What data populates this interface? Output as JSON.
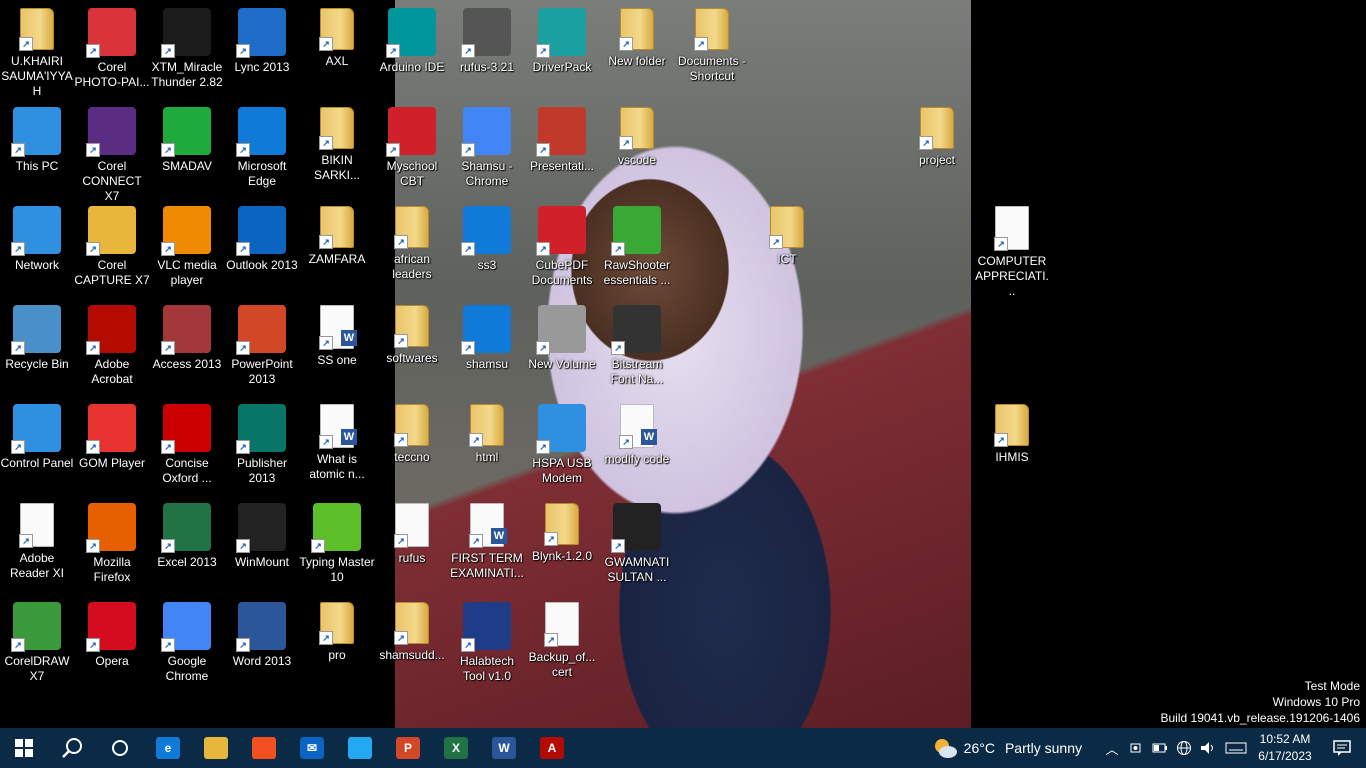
{
  "desktop": {
    "icons": [
      {
        "label": "U.KHAIRI SAUMA'IYYA H",
        "icon": "user-folder-icon",
        "color": "#e9c46a"
      },
      {
        "label": "Corel PHOTO-PAI...",
        "icon": "corel-photo-paint-icon",
        "color": "#d9343a"
      },
      {
        "label": "XTM_Miracle Thunder 2.82",
        "icon": "miracle-thunder-icon",
        "color": "#1b1b1b"
      },
      {
        "label": "Lync 2013",
        "icon": "lync-icon",
        "color": "#1e6ec8"
      },
      {
        "label": "AXL",
        "icon": "folder-icon",
        "color": "#e9c46a"
      },
      {
        "label": "Arduino IDE",
        "icon": "arduino-icon",
        "color": "#00979c"
      },
      {
        "label": "rufus-3.21",
        "icon": "usb-drive-icon",
        "color": "#555"
      },
      {
        "label": "DriverPack",
        "icon": "driverpack-icon",
        "color": "#1aa0a0"
      },
      {
        "label": "New folder",
        "icon": "folder-icon",
        "color": "#e9c46a"
      },
      {
        "label": "Documents - Shortcut",
        "icon": "documents-folder-icon",
        "color": "#e9c46a"
      },
      {
        "label": "This PC",
        "icon": "computer-icon",
        "color": "#2f8fe0"
      },
      {
        "label": "Corel CONNECT X7",
        "icon": "corel-connect-icon",
        "color": "#5a2d82"
      },
      {
        "label": "SMADAV",
        "icon": "smadav-icon",
        "color": "#1faa3c"
      },
      {
        "label": "Microsoft Edge",
        "icon": "edge-icon",
        "color": "#0f7ad8"
      },
      {
        "label": "BIKIN SARKI...",
        "icon": "folder-icon",
        "color": "#e9c46a"
      },
      {
        "label": "Myschool CBT",
        "icon": "myschool-icon",
        "color": "#d0202a"
      },
      {
        "label": "Shamsu - Chrome",
        "icon": "chrome-icon",
        "color": "#4285f4"
      },
      {
        "label": "Presentati...",
        "icon": "presentation-icon",
        "color": "#c0392b"
      },
      {
        "label": "vscode",
        "icon": "folder-icon",
        "color": "#e9c46a"
      },
      {
        "label": "project",
        "icon": "excel-folder-icon",
        "color": "#e9c46a"
      },
      {
        "label": "Network",
        "icon": "network-icon",
        "color": "#2f8fe0"
      },
      {
        "label": "Corel CAPTURE X7",
        "icon": "corel-capture-icon",
        "color": "#e9b63c"
      },
      {
        "label": "VLC media player",
        "icon": "vlc-icon",
        "color": "#f08a00"
      },
      {
        "label": "Outlook 2013",
        "icon": "outlook-icon",
        "color": "#0a64c2"
      },
      {
        "label": "ZAMFARA",
        "icon": "folder-icon",
        "color": "#e9c46a"
      },
      {
        "label": "african leaders",
        "icon": "folder-icon",
        "color": "#e9c46a"
      },
      {
        "label": "ss3",
        "icon": "edge-icon",
        "color": "#0f7ad8"
      },
      {
        "label": "CubePDF Documents",
        "icon": "cubepdf-icon",
        "color": "#d0202a"
      },
      {
        "label": "RawShooter essentials ...",
        "icon": "rawshooter-icon",
        "color": "#39a935"
      },
      {
        "label": "ICT",
        "icon": "folder-icon",
        "color": "#e9c46a"
      },
      {
        "label": "COMPUTER APPRECIATI...",
        "icon": "document-icon",
        "color": "#e0a080"
      },
      {
        "label": "Recycle Bin",
        "icon": "recycle-bin-icon",
        "color": "#4a90c8"
      },
      {
        "label": "Adobe Acrobat",
        "icon": "acrobat-icon",
        "color": "#b30b00"
      },
      {
        "label": "Access 2013",
        "icon": "access-icon",
        "color": "#a4373a"
      },
      {
        "label": "PowerPoint 2013",
        "icon": "powerpoint-icon",
        "color": "#d24726"
      },
      {
        "label": "SS one",
        "icon": "word-doc-icon",
        "color": "#2b579a"
      },
      {
        "label": "softwares",
        "icon": "folder-icon",
        "color": "#e9c46a"
      },
      {
        "label": "shamsu",
        "icon": "edge-icon",
        "color": "#0f7ad8"
      },
      {
        "label": "New Volume",
        "icon": "drive-icon",
        "color": "#999"
      },
      {
        "label": "Bitstream Font Na...",
        "icon": "bitstream-icon",
        "color": "#333"
      },
      {
        "label": "Control Panel",
        "icon": "control-panel-icon",
        "color": "#2f8fe0"
      },
      {
        "label": "GOM Player",
        "icon": "gom-player-icon",
        "color": "#e8322f"
      },
      {
        "label": "Concise Oxford ...",
        "icon": "oxford-dictionary-icon",
        "color": "#c00"
      },
      {
        "label": "Publisher 2013",
        "icon": "publisher-icon",
        "color": "#077568"
      },
      {
        "label": "What is atomic n...",
        "icon": "word-doc-icon",
        "color": "#2b579a"
      },
      {
        "label": "teccno",
        "icon": "folder-icon",
        "color": "#e9c46a"
      },
      {
        "label": "html",
        "icon": "edge-folder-icon",
        "color": "#e9c46a"
      },
      {
        "label": "HSPA USB Modem",
        "icon": "globe-icon",
        "color": "#2f8fe0"
      },
      {
        "label": "modify code",
        "icon": "word-doc-icon",
        "color": "#2b579a"
      },
      {
        "label": "IHMIS",
        "icon": "edge-folder-icon",
        "color": "#e9c46a"
      },
      {
        "label": "Adobe Reader XI",
        "icon": "blank-document-icon",
        "color": "#fafafa"
      },
      {
        "label": "Mozilla Firefox",
        "icon": "firefox-icon",
        "color": "#e66000"
      },
      {
        "label": "Excel 2013",
        "icon": "excel-icon",
        "color": "#217346"
      },
      {
        "label": "WinMount",
        "icon": "winmount-icon",
        "color": "#222"
      },
      {
        "label": "Typing Master 10",
        "icon": "typing-master-icon",
        "color": "#5cbf2a"
      },
      {
        "label": "rufus",
        "icon": "text-document-icon",
        "color": "#fafafa"
      },
      {
        "label": "FIRST TERM EXAMINATI...",
        "icon": "word-doc-icon",
        "color": "#2b579a"
      },
      {
        "label": "Blynk-1.2.0",
        "icon": "folder-icon",
        "color": "#e9c46a"
      },
      {
        "label": "GWAMNATI SULTAN ...",
        "icon": "video-file-icon",
        "color": "#222"
      },
      {
        "label": "CorelDRAW X7",
        "icon": "coreldraw-icon",
        "color": "#3a9a3a"
      },
      {
        "label": "Opera",
        "icon": "opera-icon",
        "color": "#d50b1f"
      },
      {
        "label": "Google Chrome",
        "icon": "chrome-icon",
        "color": "#4285f4"
      },
      {
        "label": "Word 2013",
        "icon": "word-icon",
        "color": "#2b579a"
      },
      {
        "label": "pro",
        "icon": "folder-icon",
        "color": "#e9c46a"
      },
      {
        "label": "shamsudd...",
        "icon": "excel-folder-icon",
        "color": "#e9c46a"
      },
      {
        "label": "Halabtech Tool v1.0",
        "icon": "halabtech-icon",
        "color": "#1f3c88"
      },
      {
        "label": "Backup_of... cert",
        "icon": "certificate-icon",
        "color": "#fafafa"
      }
    ]
  },
  "watermark": {
    "line1": "Test Mode",
    "line2": "Windows 10 Pro",
    "line3": "Build 19041.vb_release.191206-1406"
  },
  "taskbar": {
    "apps": [
      {
        "name": "edge-icon",
        "glyph": "e",
        "color": "#0f7ad8"
      },
      {
        "name": "file-explorer-icon",
        "glyph": "",
        "color": "#e9b63c"
      },
      {
        "name": "store-icon",
        "glyph": "",
        "color": "#f25022"
      },
      {
        "name": "mail-icon",
        "glyph": "✉",
        "color": "#0a64c2"
      },
      {
        "name": "vscode-icon",
        "glyph": "",
        "color": "#23a9f2"
      },
      {
        "name": "powerpoint-icon",
        "glyph": "P",
        "color": "#d24726"
      },
      {
        "name": "excel-icon",
        "glyph": "X",
        "color": "#217346"
      },
      {
        "name": "word-icon",
        "glyph": "W",
        "color": "#2b579a"
      },
      {
        "name": "acrobat-icon",
        "glyph": "A",
        "color": "#b30b00"
      }
    ],
    "weather": {
      "temp": "26°C",
      "condition": "Partly sunny"
    },
    "clock": {
      "time": "10:52 AM",
      "date": "6/17/2023"
    }
  }
}
